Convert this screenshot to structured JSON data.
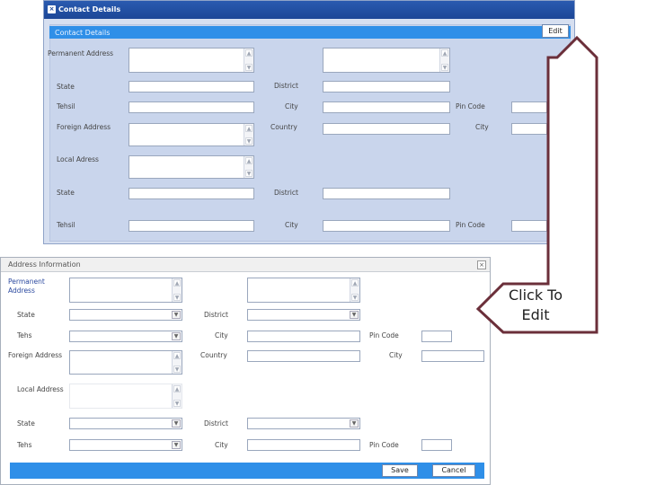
{
  "top_panel": {
    "title": "Contact Details",
    "section_bar": "Contact Details",
    "edit_label": "Edit",
    "labels": {
      "permanent_address": "Permanent Address",
      "state": "State",
      "district": "District",
      "tehsil": "Tehsil",
      "city": "City",
      "pin_code": "Pin Code",
      "foreign_address": "Foreign Address",
      "country": "Country",
      "city2": "City",
      "local_address": "Local Adress",
      "state2": "State",
      "district2": "District",
      "tehsil2": "Tehsil",
      "city3": "City",
      "pin_code2": "Pin Code"
    }
  },
  "dialog": {
    "title": "Address Information",
    "close": "×",
    "labels": {
      "permanent_address": "Permanent Address",
      "state": "State",
      "district": "District",
      "tehs": "Tehs",
      "city": "City",
      "pin_code": "Pin Code",
      "foreign_address": "Foreign Address",
      "country": "Country",
      "city2": "City",
      "local_address": "Local Address",
      "state2": "State",
      "district2": "District",
      "tehs2": "Tehs",
      "city3": "City",
      "pin_code2": "Pin Code"
    },
    "save_label": "Save",
    "cancel_label": "Cancel"
  },
  "callout": {
    "line1": "Click To",
    "line2": "Edit",
    "border_color": "#6b2f3a"
  },
  "colors": {
    "accent_blue": "#2f8fe8",
    "panel_bg": "#d6dff0",
    "title_blue": "#1c4797"
  }
}
